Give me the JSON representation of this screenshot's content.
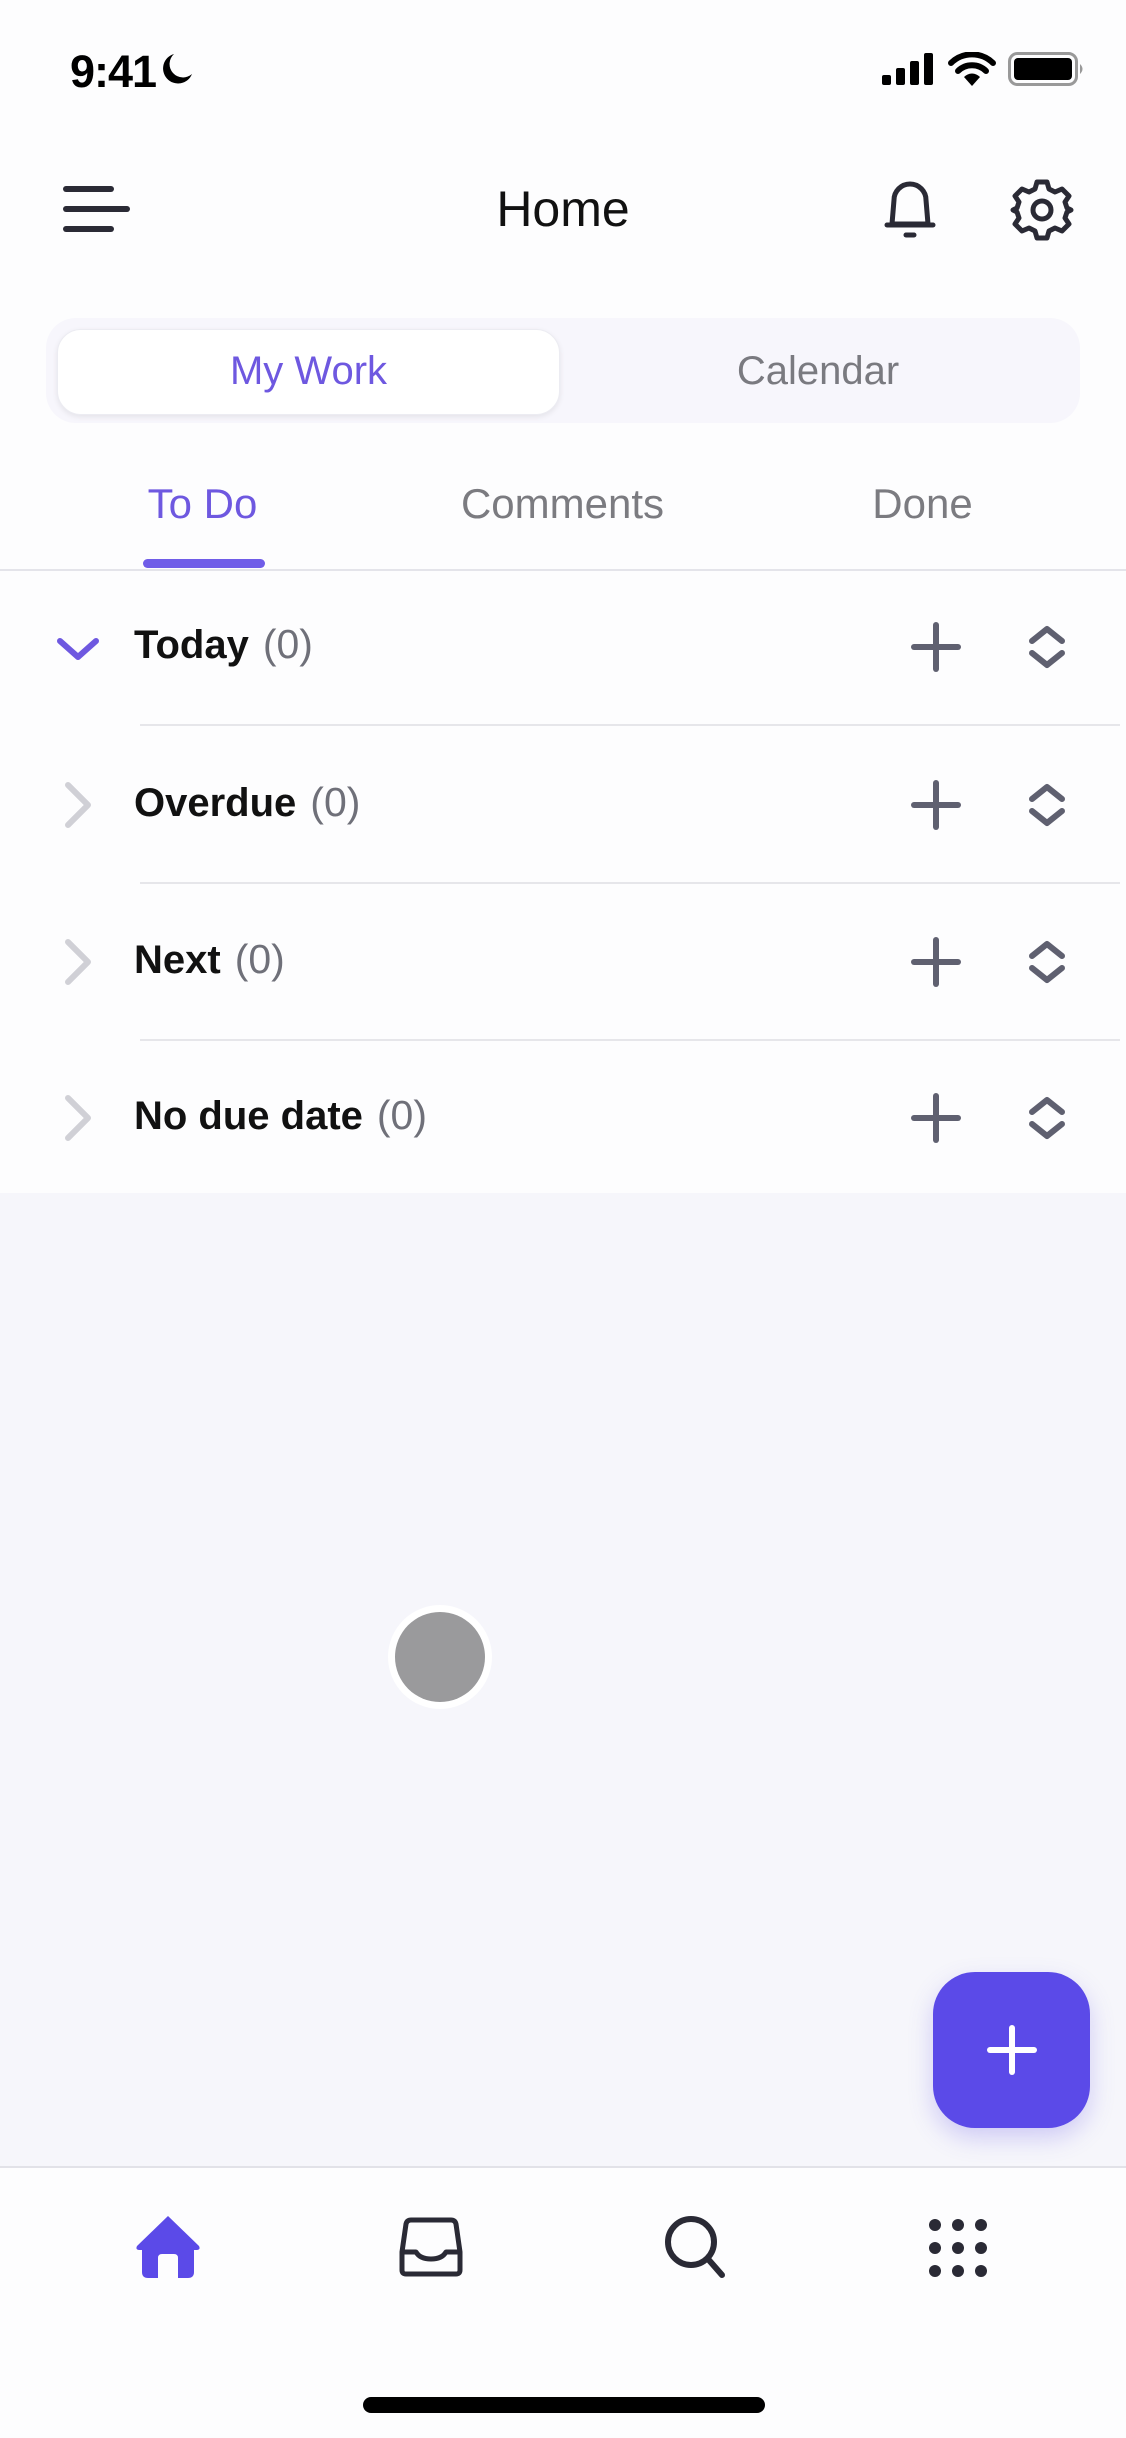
{
  "status_bar": {
    "time": "9:41",
    "icons": [
      "moon-icon",
      "signal-icon",
      "wifi-icon",
      "battery-icon"
    ]
  },
  "header": {
    "title": "Home",
    "left_icon": "menu-icon",
    "right_icons": [
      "bell-icon",
      "gear-icon"
    ]
  },
  "segmented": {
    "options": [
      {
        "label": "My Work",
        "selected": true
      },
      {
        "label": "Calendar",
        "selected": false
      }
    ]
  },
  "tabs": [
    {
      "label": "To Do",
      "active": true
    },
    {
      "label": "Comments",
      "active": false
    },
    {
      "label": "Done",
      "active": false
    }
  ],
  "sections": [
    {
      "title": "Today",
      "count": "(0)",
      "expanded": true
    },
    {
      "title": "Overdue",
      "count": "(0)",
      "expanded": false
    },
    {
      "title": "Next",
      "count": "(0)",
      "expanded": false
    },
    {
      "title": "No due date",
      "count": "(0)",
      "expanded": false
    }
  ],
  "fab": {
    "icon": "plus-icon"
  },
  "bottom_nav": [
    {
      "name": "home",
      "icon": "home-icon",
      "active": true
    },
    {
      "name": "inbox",
      "icon": "inbox-icon",
      "active": false
    },
    {
      "name": "search",
      "icon": "search-icon",
      "active": false
    },
    {
      "name": "apps",
      "icon": "grid-icon",
      "active": false
    }
  ],
  "colors": {
    "accent": "#6e58e0",
    "fab": "#5b4ae8",
    "background": "#f6f6fb",
    "text_primary": "#111111",
    "text_secondary": "#7b7b80",
    "icon_gray": "#5f6070"
  }
}
